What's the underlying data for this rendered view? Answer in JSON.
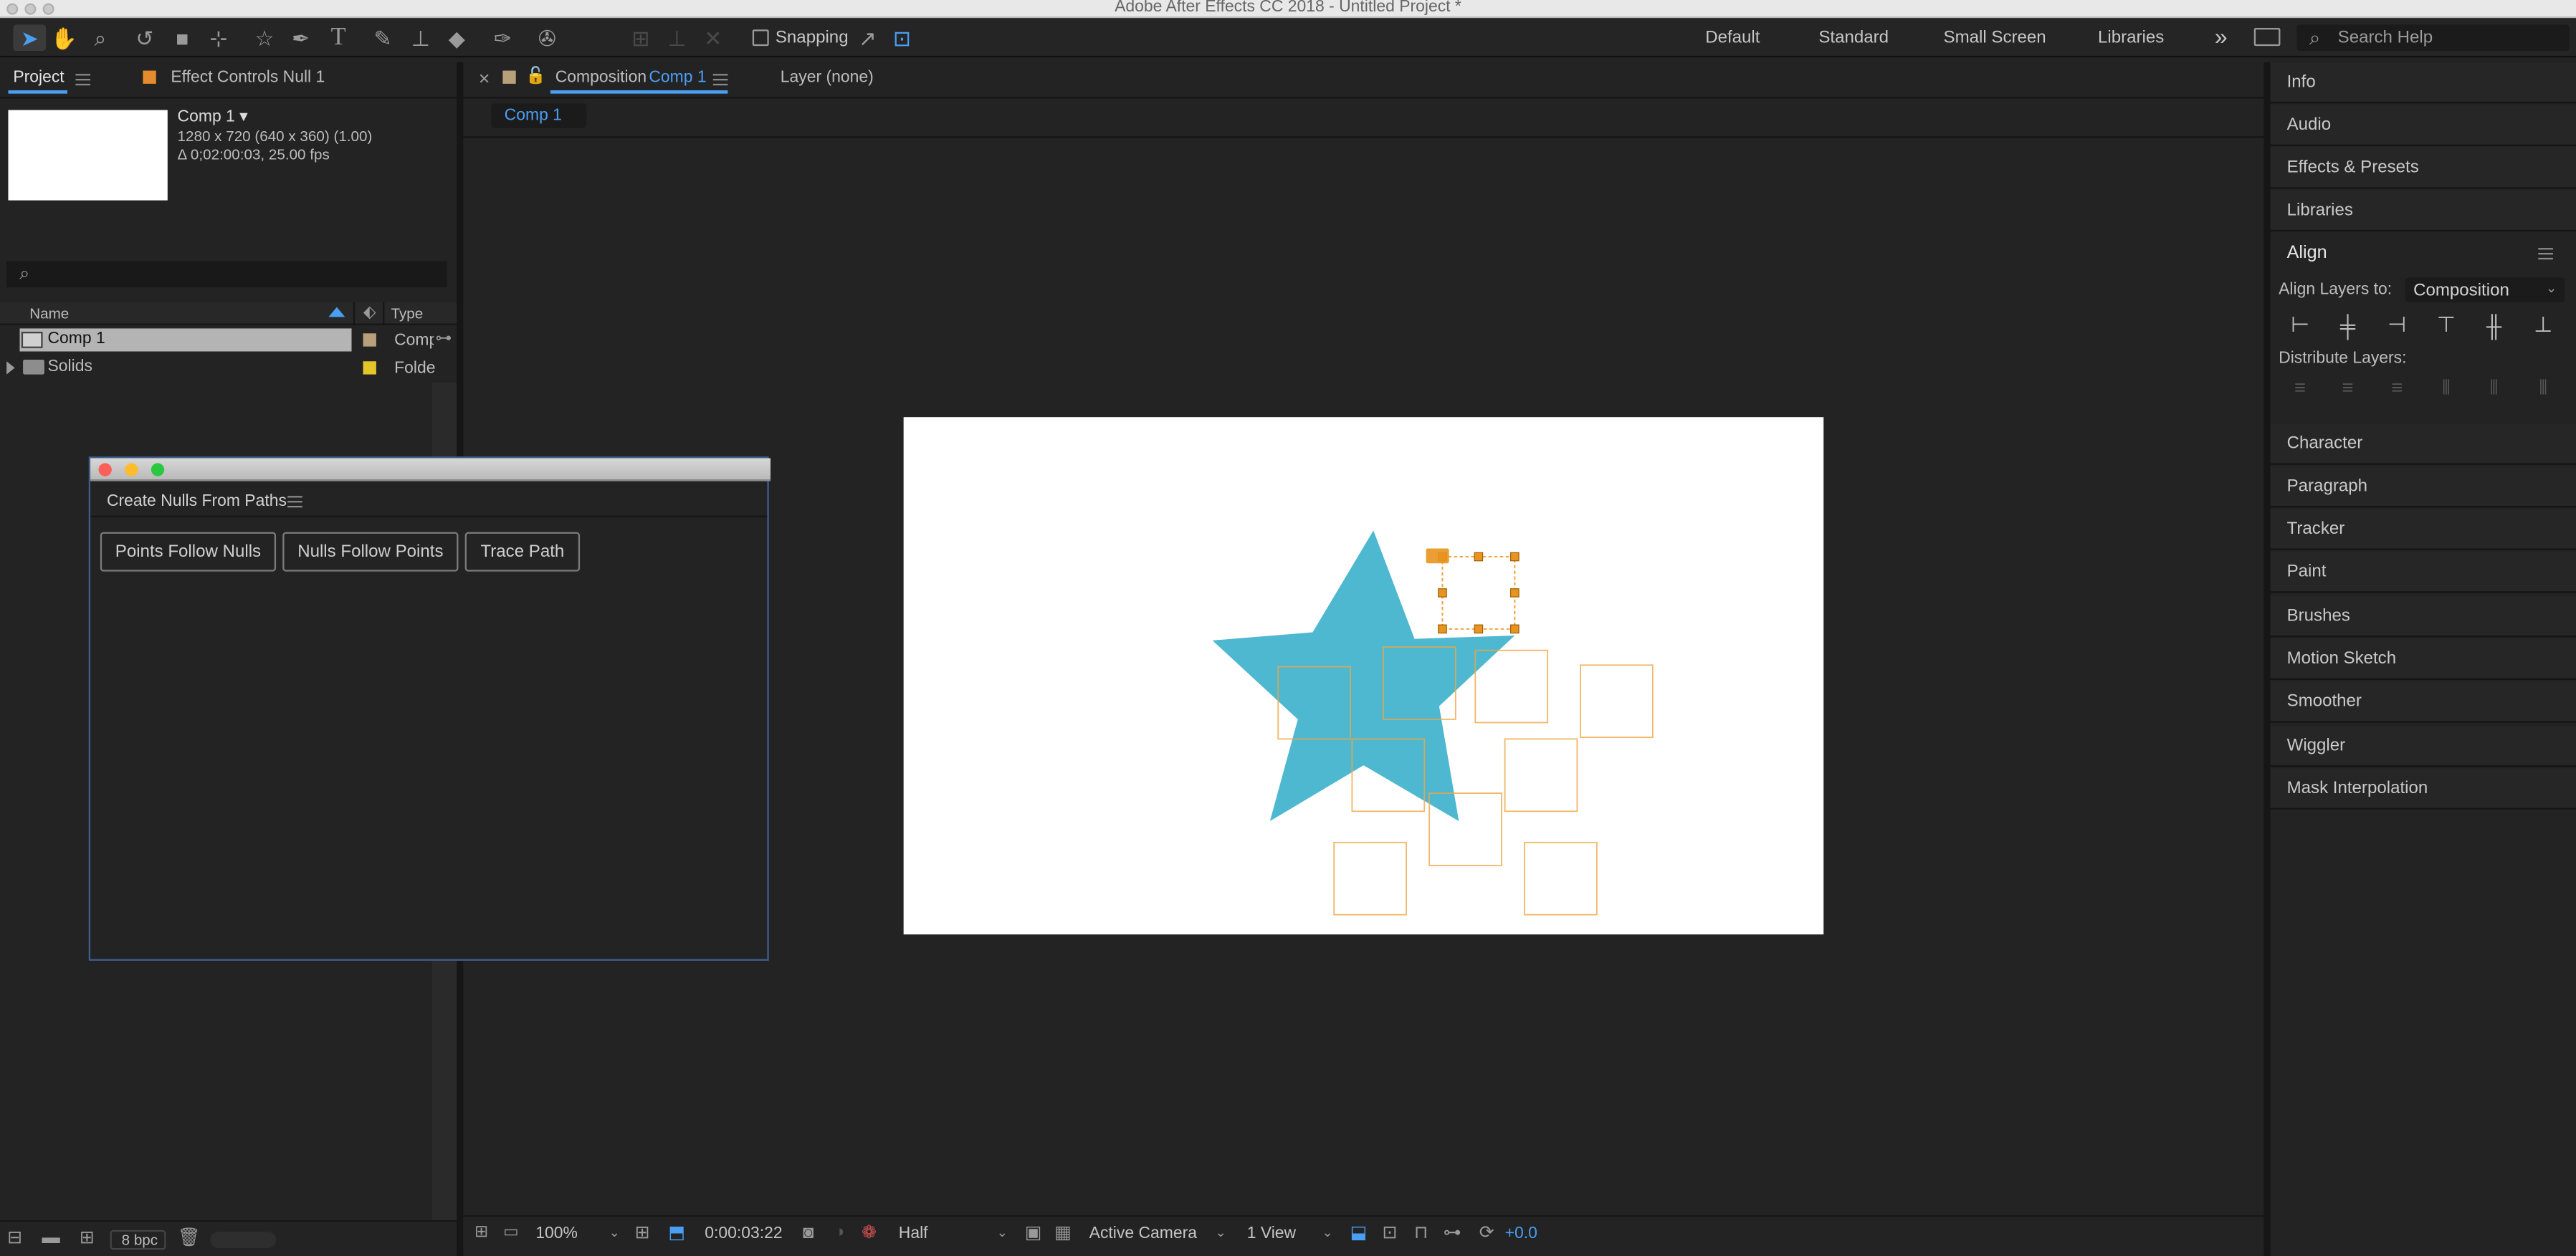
{
  "app": {
    "title": "Adobe After Effects CC 2018 - Untitled Project *"
  },
  "toolbar": {
    "snapping_label": "Snapping",
    "workspaces": [
      "Default",
      "Standard",
      "Small Screen",
      "Libraries"
    ],
    "overflow_label": "»",
    "search_placeholder": "Search Help"
  },
  "project_panel": {
    "tab_project": "Project",
    "tab_effect_controls": "Effect Controls Null 1",
    "comp_name": "Comp 1 ▾",
    "comp_dims": "1280 x 720  (640 x 360) (1.00)",
    "comp_duration": "Δ 0;02:00:03, 25.00 fps",
    "col_name": "Name",
    "col_type": "Type",
    "items": [
      {
        "name": "Comp 1",
        "type": "Comp",
        "label_color": "#b8a07a",
        "selected": true
      },
      {
        "name": "Solids",
        "type": "Folde",
        "label_color": "#e3c62a",
        "selected": false
      }
    ],
    "bpc_label": "8 bpc"
  },
  "script_panel": {
    "title": "Create Nulls From Paths",
    "buttons": [
      "Points Follow Nulls",
      "Nulls Follow Points",
      "Trace Path"
    ]
  },
  "composition_panel": {
    "tab_prefix": "Composition",
    "tab_comp": "Comp 1",
    "tab_layer": "Layer (none)",
    "breadcrumb": "Comp 1",
    "zoom": "100%",
    "timecode": "0:00:03:22",
    "resolution": "Half",
    "camera": "Active Camera",
    "views": "1 View",
    "exposure": "+0.0"
  },
  "right_panels": {
    "collapsed_top": [
      "Info",
      "Audio",
      "Effects & Presets",
      "Libraries"
    ],
    "align": {
      "title": "Align",
      "align_to_label": "Align Layers to:",
      "align_to_value": "Composition",
      "distribute_label": "Distribute Layers:"
    },
    "collapsed_bottom": [
      "Character",
      "Paragraph",
      "Tracker",
      "Paint",
      "Brushes",
      "Motion Sketch",
      "Smoother",
      "Wiggler",
      "Mask Interpolation"
    ]
  },
  "colors": {
    "star": "#4db8d0",
    "null_outline": "#f0a644",
    "accent_blue": "#4a9ff5"
  }
}
